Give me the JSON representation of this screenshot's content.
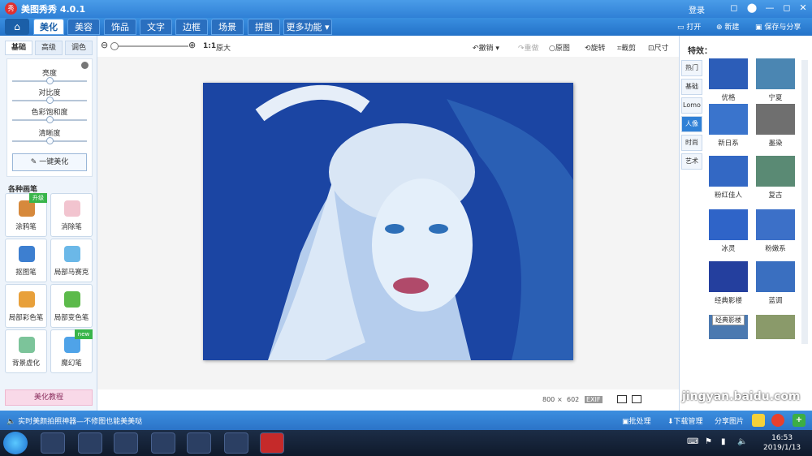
{
  "app": {
    "title": "美图秀秀 4.0.1",
    "logo_text": "秀",
    "login": "登录"
  },
  "window_buttons": [
    "◻",
    "⬤",
    "—",
    "◻",
    "✕"
  ],
  "menu": {
    "tabs": [
      "美化",
      "美容",
      "饰品",
      "文字",
      "边框",
      "场景",
      "拼图",
      "更多功能 ▾"
    ],
    "active": "美化"
  },
  "top_actions": {
    "open": "打开",
    "new": "新建",
    "save": "保存与分享"
  },
  "left": {
    "tabs": [
      "基础",
      "高级",
      "调色"
    ],
    "active_tab": "基础",
    "sliders": [
      {
        "label": "亮度",
        "value": 0.5
      },
      {
        "label": "对比度",
        "value": 0.5
      },
      {
        "label": "色彩饱和度",
        "value": 0.5
      },
      {
        "label": "清晰度",
        "value": 0.5
      }
    ],
    "one_click": "一键美化",
    "brushes_header": "各种画笔",
    "brushes": [
      {
        "label": "涂鸦笔",
        "tag": "升级"
      },
      {
        "label": "消除笔",
        "tag": ""
      },
      {
        "label": "抠图笔",
        "tag": ""
      },
      {
        "label": "局部马赛克",
        "tag": ""
      },
      {
        "label": "局部彩色笔",
        "tag": ""
      },
      {
        "label": "局部变色笔",
        "tag": ""
      },
      {
        "label": "背景虚化",
        "tag": ""
      },
      {
        "label": "魔幻笔",
        "tag": "new"
      }
    ],
    "tutorial": "美化教程"
  },
  "toolbar": {
    "zoom_ratio": "1:1",
    "zoom_text": "原大",
    "undo": "撤销",
    "redo": "重做",
    "original": "原图",
    "rotate": "旋转",
    "crop": "裁剪",
    "size": "尺寸"
  },
  "status": {
    "width": "800",
    "times": "×",
    "height": "602",
    "exif": "EXIF"
  },
  "effects": {
    "header": "特效：",
    "categories": [
      "热门",
      "基础",
      "Lomo",
      "人像",
      "时尚",
      "艺术"
    ],
    "active": "人像",
    "items": [
      "优格",
      "宁夏",
      "新日系",
      "墨染",
      "粉红佳人",
      "复古",
      "冰灵",
      "粉嫩系",
      "经典影楼",
      "蓝调",
      "",
      ""
    ],
    "tooltip": "经典影楼"
  },
  "bottom": {
    "tip": "实时美颜拍照神器—不修图也能美美哒",
    "batch": "批处理",
    "download": "下载管理",
    "share": "分享图片"
  },
  "taskbar": {
    "time": "16:53",
    "date": "2019/1/13"
  },
  "watermark": "jingyan.baidu.com"
}
